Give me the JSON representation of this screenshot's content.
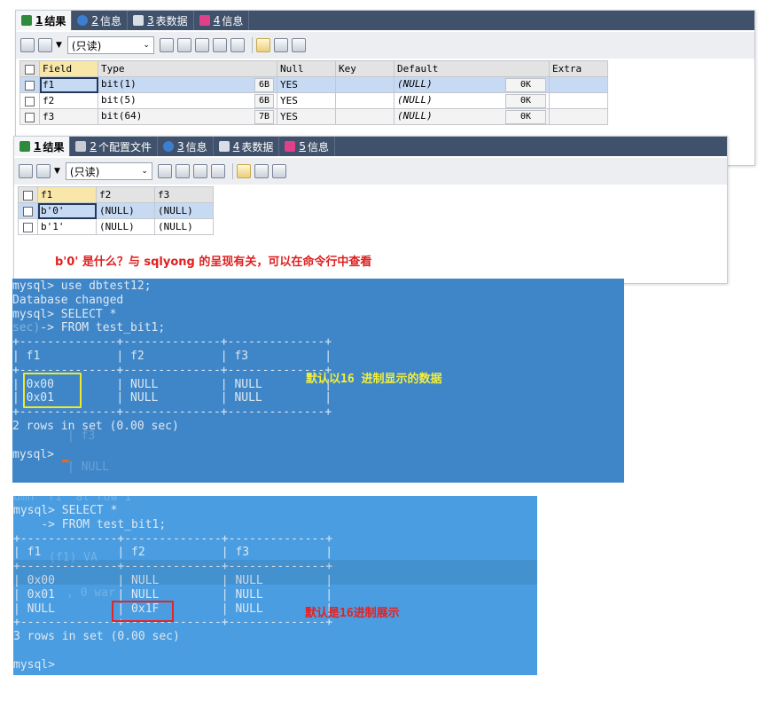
{
  "panel1": {
    "tabs": [
      {
        "num": "1",
        "label": " 结果"
      },
      {
        "num": "2",
        "label": " 信息"
      },
      {
        "num": "3",
        "label": " 表数据"
      },
      {
        "num": "4",
        "label": " 信息"
      }
    ],
    "dropdown": "(只读)",
    "headers": [
      "Field",
      "Type",
      "Null",
      "Key",
      "Default",
      "Extra"
    ],
    "rows": [
      {
        "field": "f1",
        "type": "bit(1)",
        "len": "6B",
        "null": "YES",
        "key": "",
        "default": "(NULL)",
        "ok": "0K",
        "extra": ""
      },
      {
        "field": "f2",
        "type": "bit(5)",
        "len": "6B",
        "null": "YES",
        "key": "",
        "default": "(NULL)",
        "ok": "0K",
        "extra": ""
      },
      {
        "field": "f3",
        "type": "bit(64)",
        "len": "7B",
        "null": "YES",
        "key": "",
        "default": "(NULL)",
        "ok": "0K",
        "extra": ""
      }
    ]
  },
  "panel2": {
    "tabs": [
      {
        "num": "1",
        "label": " 结果"
      },
      {
        "num": "2",
        "label": " 个配置文件"
      },
      {
        "num": "3",
        "label": " 信息"
      },
      {
        "num": "4",
        "label": " 表数据"
      },
      {
        "num": "5",
        "label": " 信息"
      }
    ],
    "dropdown": "(只读)",
    "headers": [
      "f1",
      "f2",
      "f3"
    ],
    "rows": [
      [
        "b'0'",
        "(NULL)",
        "(NULL)"
      ],
      [
        "b'1'",
        "(NULL)",
        "(NULL)"
      ]
    ],
    "note": "b'0' 是什么？与 sqlyong 的呈现有关，可以在命令行中查看"
  },
  "terminal1": {
    "lines": [
      "mysql> use dbtest12;",
      "Database changed",
      "mysql> SELECT *",
      "    -> FROM test_bit1;",
      "+--------------+--------------+--------------+",
      "| f1           | f2           | f3           |",
      "+--------------+--------------+--------------+",
      "| 0x00         | NULL         | NULL         |",
      "| 0x01         | NULL         | NULL         |",
      "+--------------+--------------+--------------+",
      "2 rows in set (0.00 sec)",
      "",
      "mysql> "
    ],
    "annotation": "默认以16 进制显示的数据",
    "ghost_sec": "sec)",
    "ghost_f3": "| f3",
    "ghost_null": "| NULL"
  },
  "terminal2": {
    "lines": [
      "mysql> SELECT *",
      "    -> FROM test_bit1;",
      "+--------------+--------------+--------------+",
      "| f1           | f2           | f3           |",
      "+--------------+--------------+--------------+",
      "| 0x00         | NULL         | NULL         |",
      "| 0x01         | NULL         | NULL         |",
      "| NULL         | 0x1F         | NULL         |",
      "+--------------+--------------+--------------+",
      "3 rows in set (0.00 sec)",
      "",
      "mysql>"
    ],
    "annotation": "默认是16进制展示",
    "ghost_top": "umn 'f1' at row 1",
    "ghost_mid": "(f1) VA",
    "ghost_warn": ", 0 war"
  },
  "colors": {
    "term1": "#3f86c8",
    "term2": "#4a9de0",
    "tabbar": "#40526b",
    "note": "#e02020",
    "yellow_box": "#f0e82a",
    "red_box": "#e0262a"
  }
}
